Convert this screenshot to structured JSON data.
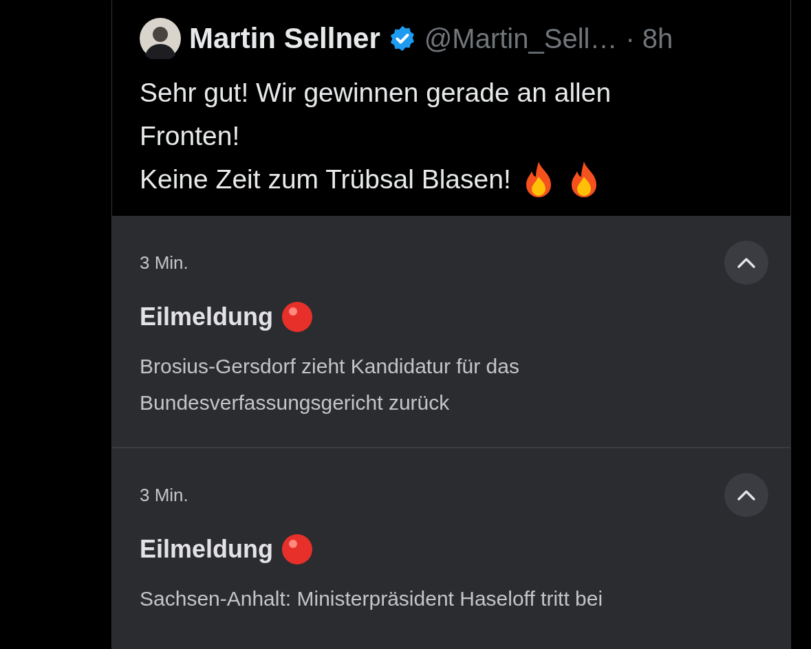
{
  "post": {
    "author": "Martin Sellner",
    "verified": true,
    "handle": "@Martin_Sell…",
    "time": "· 8h",
    "text_lines": [
      "Sehr gut! Wir gewinnen gerade an allen",
      "Fronten!",
      "Keine Zeit zum Trübsal Blasen!"
    ]
  },
  "notifications": [
    {
      "time": "3 Min.",
      "expanded": true,
      "title": "Eilmeldung",
      "body": "Brosius-Gersdorf zieht Kandidatur für das Bundesverfassungsgericht zurück"
    },
    {
      "time": "3 Min.",
      "expanded": true,
      "title": "Eilmeldung",
      "body": "Sachsen-Anhalt: Ministerpräsident Haseloff tritt bei"
    }
  ]
}
